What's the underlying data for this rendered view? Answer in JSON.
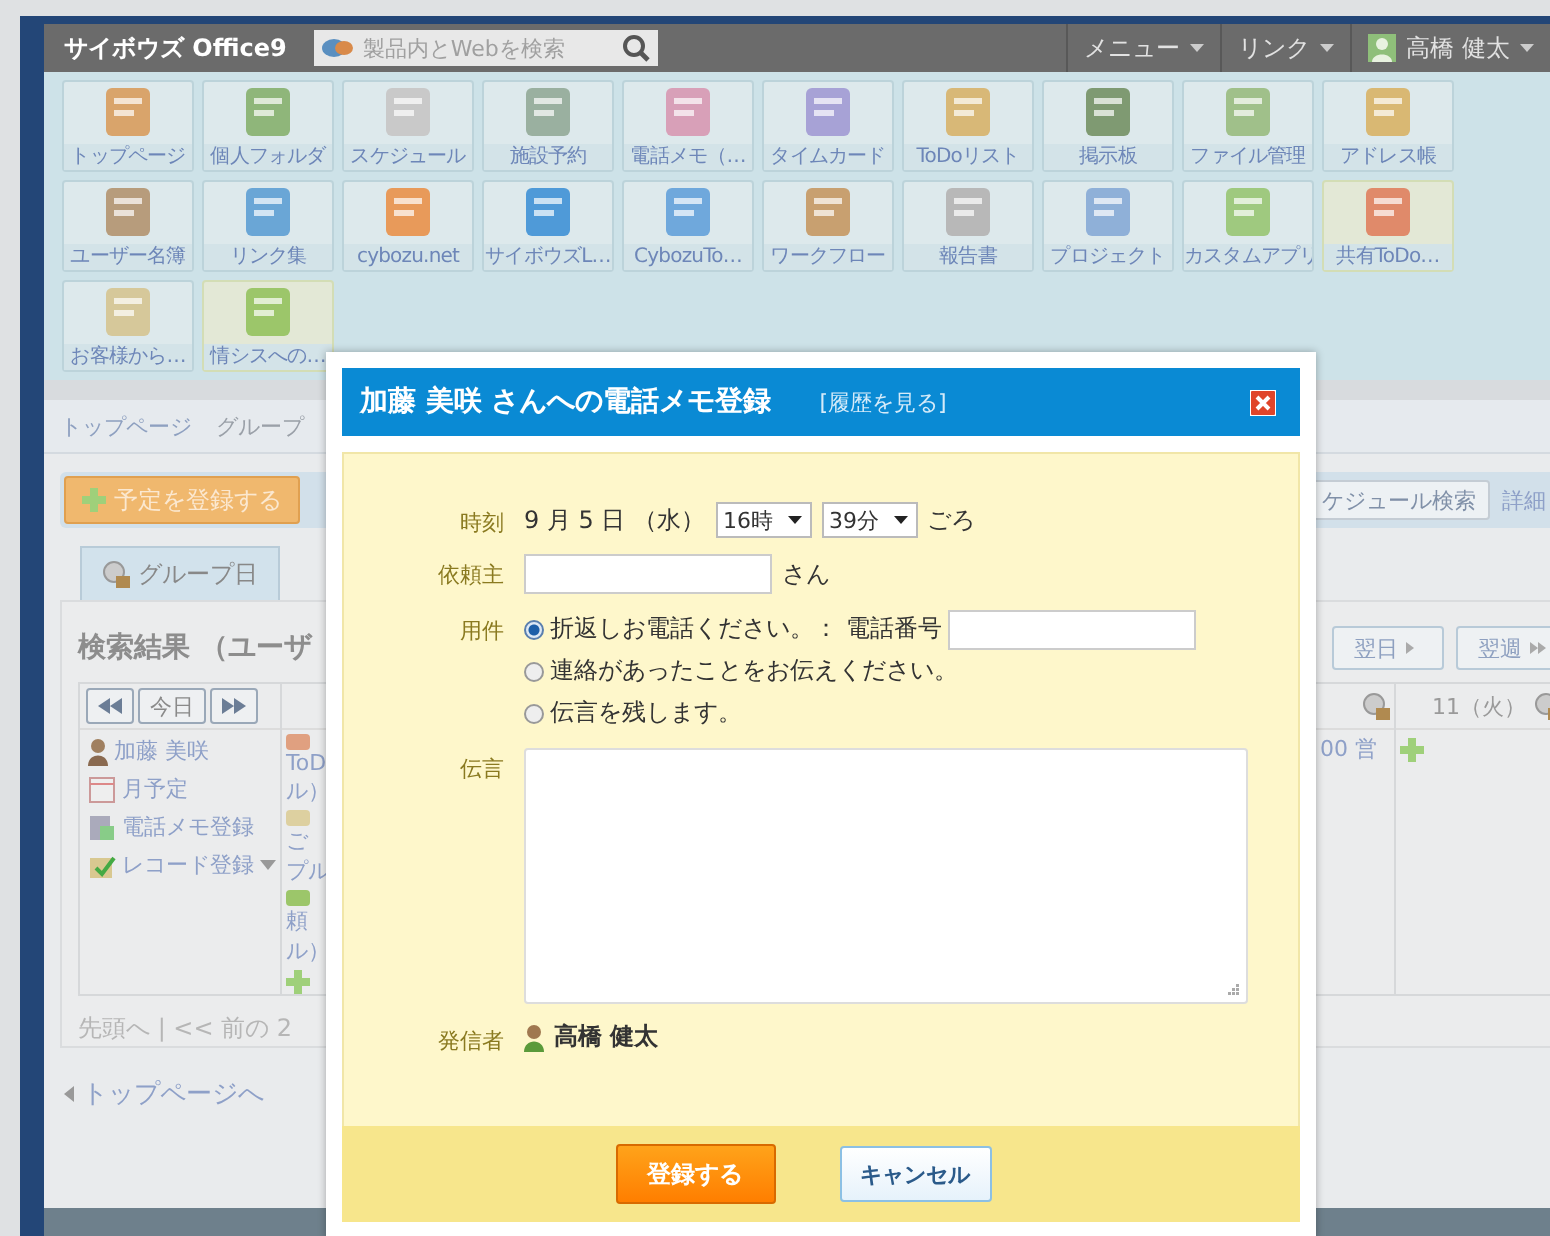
{
  "header": {
    "logo": "サイボウズ Office9",
    "search_placeholder": "製品内とWebを検索",
    "menus": [
      {
        "label": "メニュー"
      },
      {
        "label": "リンク"
      }
    ],
    "user": "高橋 健太"
  },
  "apps": [
    {
      "label": "トップページ",
      "highlighted": false
    },
    {
      "label": "個人フォルダ",
      "highlighted": false
    },
    {
      "label": "スケジュール",
      "highlighted": false
    },
    {
      "label": "施設予約",
      "highlighted": false
    },
    {
      "label": "電話メモ（…",
      "highlighted": false
    },
    {
      "label": "タイムカード",
      "highlighted": false
    },
    {
      "label": "ToDoリスト",
      "highlighted": false
    },
    {
      "label": "掲示板",
      "highlighted": false
    },
    {
      "label": "ファイル管理",
      "highlighted": false
    },
    {
      "label": "アドレス帳",
      "highlighted": false
    },
    {
      "label": "ユーザー名簿",
      "highlighted": false
    },
    {
      "label": "リンク集",
      "highlighted": false
    },
    {
      "label": "cybozu.net",
      "highlighted": false
    },
    {
      "label": "サイボウズL…",
      "highlighted": false
    },
    {
      "label": "CybozuTo…",
      "highlighted": false
    },
    {
      "label": "ワークフロー",
      "highlighted": false
    },
    {
      "label": "報告書",
      "highlighted": false
    },
    {
      "label": "プロジェクト",
      "highlighted": false
    },
    {
      "label": "カスタムアプリ",
      "highlighted": false
    },
    {
      "label": "共有ToDo…",
      "highlighted": true
    },
    {
      "label": "お客様から…",
      "highlighted": false
    },
    {
      "label": "情シスへの…",
      "highlighted": true
    }
  ],
  "breadcrumb": [
    "トップページ",
    "グループ"
  ],
  "toolbar": {
    "add_button": "予定を登録する",
    "search_button": "ケジュール検索",
    "detail_link": "詳細"
  },
  "tabs": [
    {
      "label": "グループ日",
      "selected": true
    }
  ],
  "results": {
    "title": "検索結果 （ユーザ",
    "today_button": "今日",
    "next_buttons": [
      "翌日",
      "翌週"
    ],
    "day_header": "11（火）",
    "user": "加藤 美咲",
    "actions": [
      {
        "label": "月予定",
        "kind": "calendar"
      },
      {
        "label": "電話メモ登録",
        "kind": "memo"
      },
      {
        "label": "レコード登録",
        "kind": "record"
      }
    ],
    "fragments": [
      {
        "lines": [
          "ToD",
          "ル）"
        ]
      },
      {
        "lines": [
          "ご",
          "プル"
        ]
      },
      {
        "lines": [
          "頼",
          "ル）"
        ]
      }
    ],
    "event_tail": "00 営",
    "pager": "先頭へ | << 前の 2"
  },
  "back_link": "トップページへ",
  "dialog": {
    "title": "加藤 美咲 さんへの電話メモ登録",
    "history_link": "[履歴を見る]",
    "time": {
      "label": "時刻",
      "date": "9 月 5 日 （水）",
      "hour": "16時",
      "minute": "39分",
      "suffix": "ごろ"
    },
    "requester": {
      "label": "依頼主",
      "suffix": "さん"
    },
    "purpose": {
      "label": "用件",
      "options": [
        {
          "label": "折返しお電話ください。： 電話番号",
          "selected": true,
          "kind": "phone"
        },
        {
          "label": "連絡があったことをお伝えください。",
          "selected": false,
          "kind": "plain"
        },
        {
          "label": "伝言を残します。",
          "selected": false,
          "kind": "plain"
        }
      ]
    },
    "message": {
      "label": "伝言"
    },
    "sender": {
      "label": "発信者",
      "name": "高橋 健太"
    },
    "buttons": {
      "submit": "登録する",
      "cancel": "キャンセル"
    }
  }
}
